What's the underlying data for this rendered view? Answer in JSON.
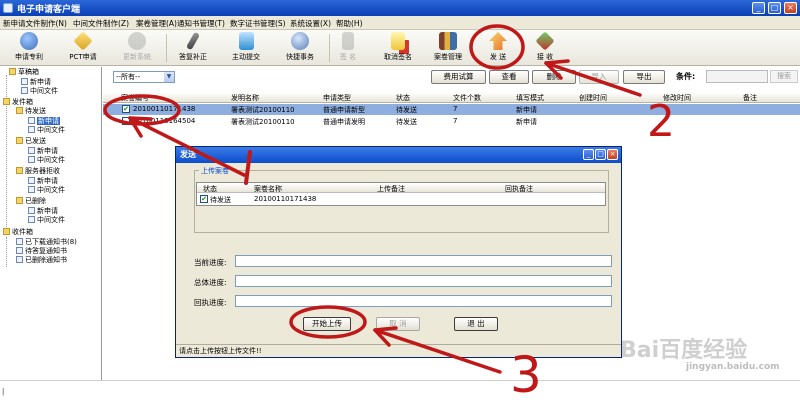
{
  "window": {
    "title": "电子申请客户端",
    "controls": [
      "_",
      "□",
      "×"
    ]
  },
  "menu": [
    "新申请文件制作(N)",
    "中间文件制作(Z)",
    "案卷管理(A)",
    "通知书管理(T)",
    "数字证书管理(S)",
    "系统设置(X)",
    "帮助(H)"
  ],
  "toolbar": [
    {
      "label": "申请专利",
      "icon": "globe-icon",
      "color": "#3f6fb8",
      "enabled": true
    },
    {
      "label": "PCT申请",
      "icon": "pct-icon",
      "color": "#d9a425",
      "enabled": true
    },
    {
      "label": "更新系统",
      "icon": "update-icon",
      "color": "#8a8a8a",
      "enabled": false
    },
    {
      "label": "答复补正",
      "icon": "pen-icon",
      "color": "#4b4b4b",
      "enabled": true
    },
    {
      "label": "主动提交",
      "icon": "document-icon",
      "color": "#2f8fd0",
      "enabled": true
    },
    {
      "label": "快捷事务",
      "icon": "gear-globe-icon",
      "color": "#5a7fb0",
      "enabled": true
    },
    {
      "label": "签 名",
      "icon": "sign-icon",
      "color": "#8a8a8a",
      "enabled": false
    },
    {
      "label": "取消签名",
      "icon": "cancel-sign-icon",
      "color": "#d8342a",
      "enabled": true
    },
    {
      "label": "案卷管理",
      "icon": "books-icon",
      "color": "#7b3f2e",
      "enabled": true
    },
    {
      "label": "发 送",
      "icon": "send-icon",
      "color": "#e4712b",
      "enabled": true
    },
    {
      "label": "接 收",
      "icon": "receive-icon",
      "color": "#c0312b",
      "enabled": true
    }
  ],
  "tree": [
    {
      "label": "草稿箱",
      "level": 0
    },
    {
      "label": "新申请",
      "level": 1
    },
    {
      "label": "中间文件",
      "level": 1
    },
    {
      "label": "发件箱",
      "level": 0
    },
    {
      "label": "待发送",
      "level": 1
    },
    {
      "label": "新申请",
      "level": 2,
      "selected": true
    },
    {
      "label": "中间文件",
      "level": 2
    },
    {
      "label": "已发送",
      "level": 1
    },
    {
      "label": "新申请",
      "level": 2
    },
    {
      "label": "中间文件",
      "level": 2
    },
    {
      "label": "服务器拒收",
      "level": 1
    },
    {
      "label": "新申请",
      "level": 2
    },
    {
      "label": "中间文件",
      "level": 2
    },
    {
      "label": "已删除",
      "level": 1
    },
    {
      "label": "新申请",
      "level": 2
    },
    {
      "label": "中间文件",
      "level": 2
    },
    {
      "label": "收件箱",
      "level": 0
    },
    {
      "label": "已下载通知书(8)",
      "level": 1
    },
    {
      "label": "待答复通知书",
      "level": 1
    },
    {
      "label": "已删除通知书",
      "level": 1
    }
  ],
  "filter": {
    "value": "--所有--"
  },
  "actions": [
    {
      "label": "费用试算",
      "enabled": true
    },
    {
      "label": "查看",
      "enabled": true
    },
    {
      "label": "删除",
      "enabled": true
    },
    {
      "label": "导入",
      "enabled": false
    },
    {
      "label": "导出",
      "enabled": true
    }
  ],
  "search": {
    "condition_label": "条件:",
    "button": "搜索"
  },
  "grid": {
    "columns": [
      "案卷编号",
      "发明名称",
      "申请类型",
      "状态",
      "文件个数",
      "填写模式",
      "创建时间",
      "修改时间",
      "备注"
    ],
    "rows": [
      {
        "checked": true,
        "id": "20100110171438",
        "name": "署表测试20100110",
        "type": "普通申请新型",
        "status": "待发送",
        "count": "7",
        "mode": "新申请",
        "selected": true
      },
      {
        "checked": false,
        "id": "20100110164504",
        "name": "署表测试20100110",
        "type": "普通申请发明",
        "status": "待发送",
        "count": "7",
        "mode": "新申请",
        "selected": false
      }
    ]
  },
  "dialog": {
    "title": "发送",
    "group_title": "上传案卷",
    "columns": [
      "状态",
      "案卷名称",
      "上传备注",
      "回执备注"
    ],
    "row": {
      "checked": true,
      "status": "待发送",
      "name": "20100110171438",
      "upload_note": "",
      "receipt_note": ""
    },
    "progress": [
      {
        "label": "当前进度:",
        "value": 0
      },
      {
        "label": "总体进度:",
        "value": 0
      },
      {
        "label": "回执进度:",
        "value": 0
      }
    ],
    "buttons": {
      "start": "开始上传",
      "cancel": "取 消",
      "exit": "退 出"
    },
    "status_text": "请点击上传按钮上传文件!!"
  },
  "annotations": {
    "numbers": [
      "1",
      "2",
      "3"
    ],
    "color": "#c01818"
  },
  "watermark": {
    "logo": "Bai百度经验",
    "url": "jingyan.baidu.com"
  }
}
